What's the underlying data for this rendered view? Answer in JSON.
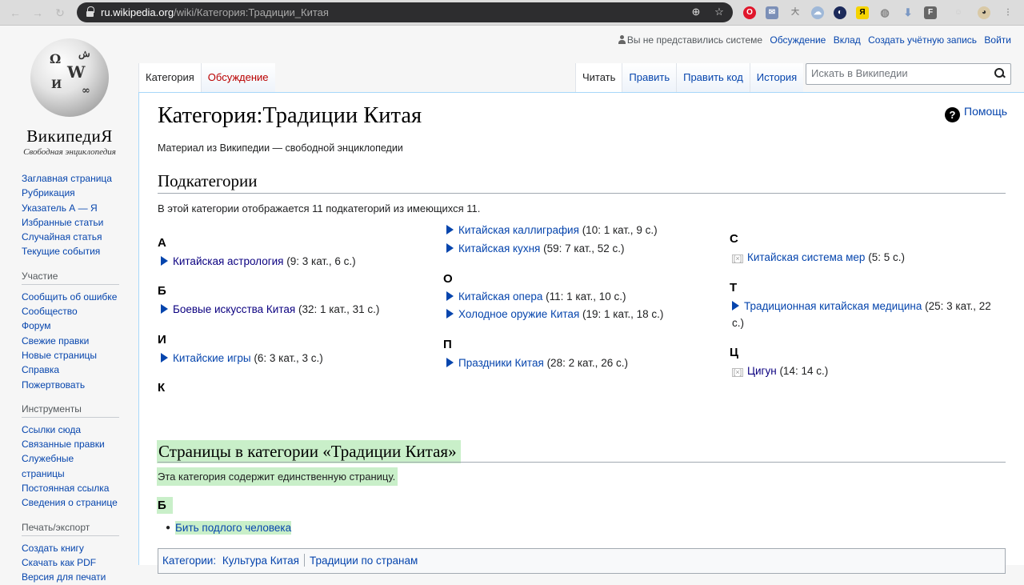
{
  "browser": {
    "url_host": "ru.wikipedia.org",
    "url_path": "/wiki/Категория:Традиции_Китая",
    "icons": [
      "back-arrow",
      "forward-arrow",
      "reload",
      "lock",
      "zoom",
      "star",
      "opera",
      "mail",
      "dictionary",
      "cloud",
      "half-circle",
      "yandex",
      "globe",
      "download",
      "flipboard",
      "ghost",
      "avatar"
    ]
  },
  "logo": {
    "wordmark": "ВикипедиЯ",
    "tagline": "Свободная энциклопедия"
  },
  "sidebar": {
    "nav": [
      "Заглавная страница",
      "Рубрикация",
      "Указатель А — Я",
      "Избранные статьи",
      "Случайная статья",
      "Текущие события"
    ],
    "participation_heading": "Участие",
    "participation": [
      "Сообщить об ошибке",
      "Сообщество",
      "Форум",
      "Свежие правки",
      "Новые страницы",
      "Справка",
      "Пожертвовать"
    ],
    "tools_heading": "Инструменты",
    "tools": [
      "Ссылки сюда",
      "Связанные правки",
      "Служебные страницы",
      "Постоянная ссылка",
      "Сведения о странице"
    ],
    "print_heading": "Печать/экспорт",
    "print": [
      "Создать книгу",
      "Скачать как PDF",
      "Версия для печати"
    ]
  },
  "personal": {
    "not_logged": "Вы не представились системе",
    "talk": "Обсуждение",
    "contributions": "Вклад",
    "create_account": "Создать учётную запись",
    "login": "Войти"
  },
  "tabs": {
    "category": "Категория",
    "discussion": "Обсуждение",
    "read": "Читать",
    "edit": "Править",
    "edit_source": "Править код",
    "history": "История"
  },
  "search": {
    "placeholder": "Искать в Википедии"
  },
  "article": {
    "title": "Категория:Традиции Китая",
    "help": "Помощь",
    "site_sub": "Материал из Википедии — свободной энциклопедии",
    "subcats_heading": "Подкатегории",
    "subcats_count": "В этой категории отображается 11 подкатегорий из имеющихся 11.",
    "col1": {
      "A": "А",
      "astro_link": "Китайская астрология",
      "astro_info": "(9: 3 кат., 6 с.)",
      "B": "Б",
      "martial_link": "Боевые искусства Китая",
      "martial_info": "(32: 1 кат., 31 с.)",
      "I": "И",
      "games_link": "Китайские игры",
      "games_info": "(6: 3 кат., 3 с.)",
      "K": "К"
    },
    "col2": {
      "calli_link": "Китайская каллиграфия",
      "calli_info": "(10: 1 кат., 9 с.)",
      "cuisine_link": "Китайская кухня",
      "cuisine_info": "(59: 7 кат., 52 с.)",
      "O": "О",
      "opera_link": "Китайская опера",
      "opera_info": "(11: 1 кат., 10 с.)",
      "weapons_link": "Холодное оружие Китая",
      "weapons_info": "(19: 1 кат., 18 с.)",
      "P": "П",
      "holidays_link": "Праздники Китая",
      "holidays_info": "(28: 2 кат., 26 с.)"
    },
    "col3": {
      "S": "С",
      "measures_link": "Китайская система мер",
      "measures_info": "(5: 5 с.)",
      "T": "Т",
      "medicine_link": "Традиционная китайская медицина",
      "medicine_info": "(25: 3 кат., 22",
      "medicine_info2": "с.)",
      "TS": "Ц",
      "qigong_link": "Цигун",
      "qigong_info": "(14: 14 с.)",
      "empty_mark": "[×]"
    },
    "pages_heading": "Страницы в категории «Традиции Китая»",
    "pages_count": "Эта категория содержит единственную страницу.",
    "pages_letter": "Б",
    "page_link": "Бить подлого человека",
    "catlinks_label": "Категории:",
    "catlinks": [
      "Культура Китая",
      "Традиции по странам"
    ]
  }
}
